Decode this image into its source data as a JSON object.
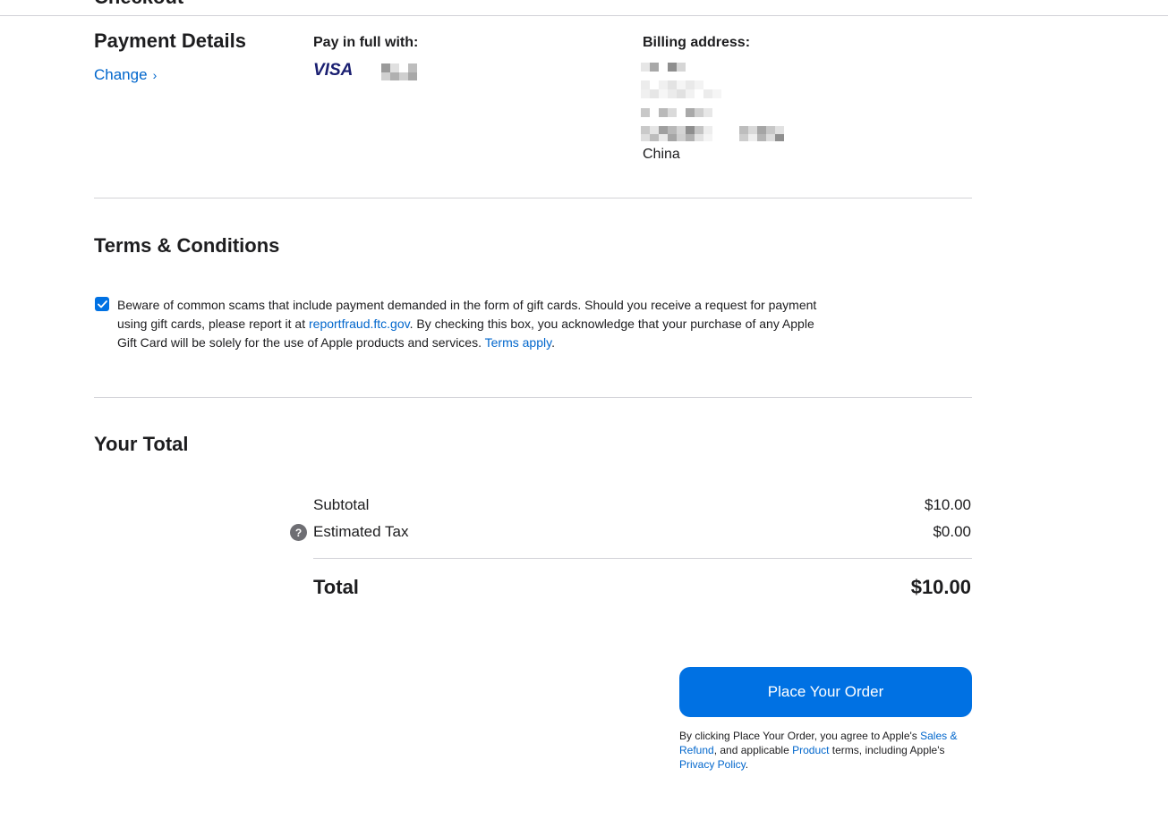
{
  "header": {
    "title": "Checkout"
  },
  "payment": {
    "heading": "Payment Details",
    "change_label": "Change",
    "pay_in_full_label": "Pay in full with:",
    "card_brand": "VISA",
    "billing_label": "Billing address:",
    "billing_country": "China"
  },
  "terms": {
    "heading": "Terms & Conditions",
    "checked": true,
    "text_part1": "Beware of common scams that include payment demanded in the form of gift cards. Should you receive a request for payment using gift cards, please report it at ",
    "link_ftc": "reportfraud.ftc.gov",
    "text_part2": ". By checking this box, you acknowledge that your purchase of any Apple Gift Card will be solely for the use of Apple products and services. ",
    "link_terms": "Terms apply",
    "text_part3": "."
  },
  "total": {
    "heading": "Your Total",
    "subtotal_label": "Subtotal",
    "subtotal_value": "$10.00",
    "tax_label": "Estimated Tax",
    "tax_value": "$0.00",
    "total_label": "Total",
    "total_value": "$10.00"
  },
  "order": {
    "button_label": "Place Your Order",
    "legal_part1": "By clicking Place Your Order, you agree to Apple's ",
    "legal_link1": "Sales & Refund",
    "legal_part2": ", and applicable ",
    "legal_link2": "Product",
    "legal_part3": " terms, including Apple's ",
    "legal_link3": "Privacy Policy",
    "legal_part4": "."
  },
  "colors": {
    "accent": "#0071e3",
    "link": "#0066cc",
    "text": "#1d1d1f",
    "divider": "#d2d2d7"
  }
}
